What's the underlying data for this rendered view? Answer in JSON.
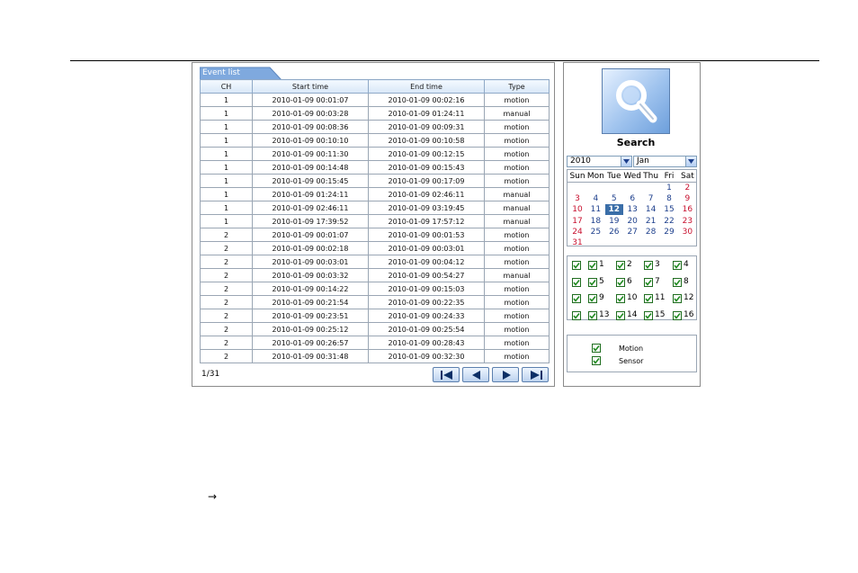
{
  "event_list": {
    "tab_label": "Event list",
    "columns": [
      "CH",
      "Start time",
      "End time",
      "Type"
    ],
    "rows": [
      [
        "1",
        "2010-01-09 00:01:07",
        "2010-01-09 00:02:16",
        "motion"
      ],
      [
        "1",
        "2010-01-09 00:03:28",
        "2010-01-09 01:24:11",
        "manual"
      ],
      [
        "1",
        "2010-01-09 00:08:36",
        "2010-01-09 00:09:31",
        "motion"
      ],
      [
        "1",
        "2010-01-09 00:10:10",
        "2010-01-09 00:10:58",
        "motion"
      ],
      [
        "1",
        "2010-01-09 00:11:30",
        "2010-01-09 00:12:15",
        "motion"
      ],
      [
        "1",
        "2010-01-09 00:14:48",
        "2010-01-09 00:15:43",
        "motion"
      ],
      [
        "1",
        "2010-01-09 00:15:45",
        "2010-01-09 00:17:09",
        "motion"
      ],
      [
        "1",
        "2010-01-09 01:24:11",
        "2010-01-09 02:46:11",
        "manual"
      ],
      [
        "1",
        "2010-01-09 02:46:11",
        "2010-01-09 03:19:45",
        "manual"
      ],
      [
        "1",
        "2010-01-09 17:39:52",
        "2010-01-09 17:57:12",
        "manual"
      ],
      [
        "2",
        "2010-01-09 00:01:07",
        "2010-01-09 00:01:53",
        "motion"
      ],
      [
        "2",
        "2010-01-09 00:02:18",
        "2010-01-09 00:03:01",
        "motion"
      ],
      [
        "2",
        "2010-01-09 00:03:01",
        "2010-01-09 00:04:12",
        "motion"
      ],
      [
        "2",
        "2010-01-09 00:03:32",
        "2010-01-09 00:54:27",
        "manual"
      ],
      [
        "2",
        "2010-01-09 00:14:22",
        "2010-01-09 00:15:03",
        "motion"
      ],
      [
        "2",
        "2010-01-09 00:21:54",
        "2010-01-09 00:22:35",
        "motion"
      ],
      [
        "2",
        "2010-01-09 00:23:51",
        "2010-01-09 00:24:33",
        "motion"
      ],
      [
        "2",
        "2010-01-09 00:25:12",
        "2010-01-09 00:25:54",
        "motion"
      ],
      [
        "2",
        "2010-01-09 00:26:57",
        "2010-01-09 00:28:43",
        "motion"
      ],
      [
        "2",
        "2010-01-09 00:31:48",
        "2010-01-09 00:32:30",
        "motion"
      ]
    ],
    "page_info": "1/31",
    "pager_icons": [
      "first-page-icon",
      "prev-page-icon",
      "next-page-icon",
      "last-page-icon"
    ]
  },
  "search": {
    "button_label": "Search",
    "icon": "magnifier-icon",
    "year_selected": "2010",
    "month_selected": "Jan"
  },
  "calendar": {
    "weekdays": [
      "Sun",
      "Mon",
      "Tue",
      "Wed",
      "Thu",
      "Fri",
      "Sat"
    ],
    "weeks": [
      [
        "",
        "",
        "",
        "",
        "",
        "1",
        "2"
      ],
      [
        "3",
        "4",
        "5",
        "6",
        "7",
        "8",
        "9"
      ],
      [
        "10",
        "11",
        "12",
        "13",
        "14",
        "15",
        "16"
      ],
      [
        "17",
        "18",
        "19",
        "20",
        "21",
        "22",
        "23"
      ],
      [
        "24",
        "25",
        "26",
        "27",
        "28",
        "29",
        "30"
      ],
      [
        "31",
        "",
        "",
        "",
        "",
        "",
        ""
      ]
    ],
    "selected_day": "12"
  },
  "channels": {
    "all_rows_checked": true,
    "rows": [
      [
        "1",
        "2",
        "3",
        "4"
      ],
      [
        "5",
        "6",
        "7",
        "8"
      ],
      [
        "9",
        "10",
        "11",
        "12"
      ],
      [
        "13",
        "14",
        "15",
        "16"
      ]
    ]
  },
  "event_types": [
    {
      "label": "Motion",
      "checked": true
    },
    {
      "label": "Sensor",
      "checked": true
    }
  ],
  "footer_arrow": "→",
  "colors": {
    "tab_blue": "#7fa9de",
    "calendar_red": "#c8102e",
    "calendar_blue": "#1d3f8c",
    "selected_day_bg": "#3a6ea8",
    "check_green": "#1f8a1f"
  }
}
